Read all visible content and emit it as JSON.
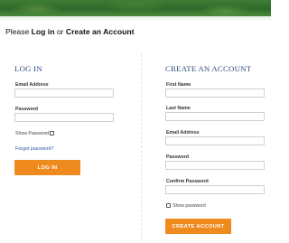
{
  "heading": {
    "prefix": "Please ",
    "login": "Log in",
    "or": " or ",
    "create": "Create an Account"
  },
  "login": {
    "title": "LOG IN",
    "email_label": "Email Address",
    "email_value": "",
    "password_label": "Password",
    "password_value": "",
    "show_password": "Show Password",
    "forgot": "Forgot password?",
    "submit": "LOG IN"
  },
  "register": {
    "title": "CREATE AN ACCOUNT",
    "first_name_label": "First Name",
    "last_name_label": "Last Name",
    "email_label": "Email Address",
    "password_label": "Password",
    "confirm_label": "Confirm Password",
    "show_password": "Show password",
    "submit": "CREATE ACCOUNT"
  },
  "colors": {
    "accent": "#ef8a1e",
    "title": "#2c4a7c",
    "link": "#2c5aa0",
    "banner": "#2f6a2a"
  }
}
